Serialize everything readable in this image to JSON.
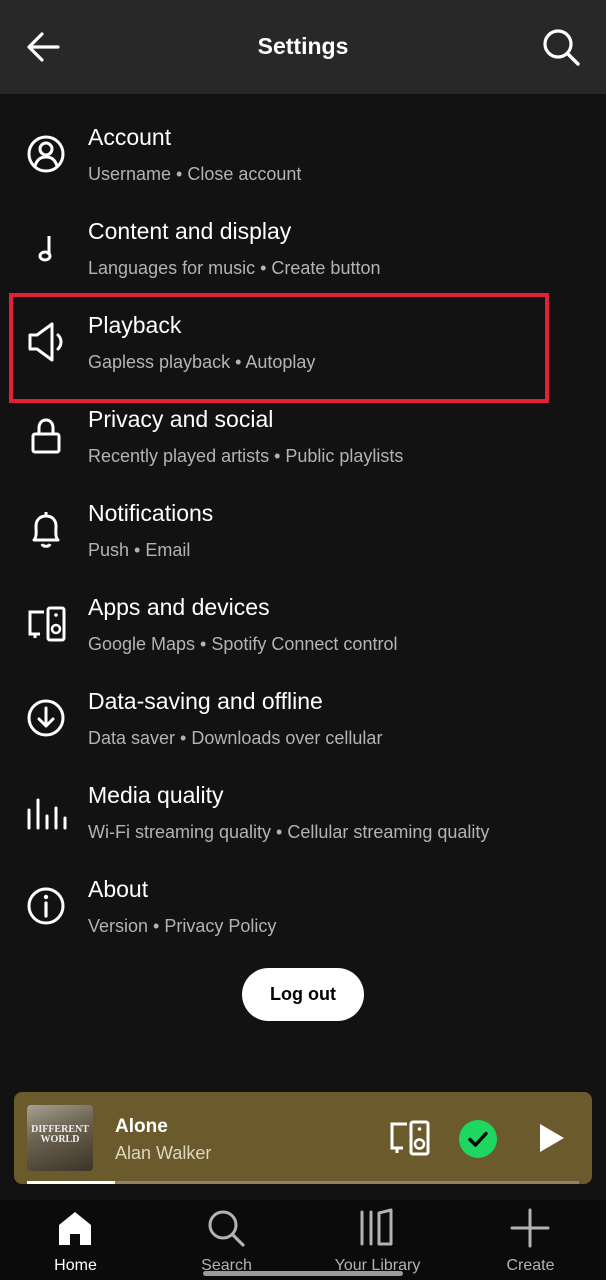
{
  "header": {
    "title": "Settings",
    "back_icon": "arrow-left-icon",
    "search_icon": "search-icon"
  },
  "settings": [
    {
      "label": "Account",
      "sub": "Username • Close account",
      "icon": "account-icon"
    },
    {
      "label": "Content and display",
      "sub": "Languages for music • Create button",
      "icon": "music-note-icon"
    },
    {
      "label": "Playback",
      "sub": "Gapless playback • Autoplay",
      "icon": "speaker-icon"
    },
    {
      "label": "Privacy and social",
      "sub": "Recently played artists • Public playlists",
      "icon": "lock-icon"
    },
    {
      "label": "Notifications",
      "sub": "Push • Email",
      "icon": "bell-icon"
    },
    {
      "label": "Apps and devices",
      "sub": "Google Maps • Spotify Connect control",
      "icon": "devices-icon"
    },
    {
      "label": "Data-saving and offline",
      "sub": "Data saver • Downloads over cellular",
      "icon": "download-icon"
    },
    {
      "label": "Media quality",
      "sub": "Wi-Fi streaming quality • Cellular streaming quality",
      "icon": "equalizer-icon"
    },
    {
      "label": "About",
      "sub": "Version • Privacy Policy",
      "icon": "info-icon"
    }
  ],
  "highlight_color": "#e22134",
  "logout_label": "Log out",
  "player": {
    "album_art_text": "DIFFERENT WORLD",
    "track": "Alone",
    "artist": "Alan Walker",
    "progress": 0.16,
    "accent": "#1ed760"
  },
  "nav": {
    "items": [
      {
        "label": "Home",
        "icon": "home-icon",
        "active": true
      },
      {
        "label": "Search",
        "icon": "search-icon",
        "active": false
      },
      {
        "label": "Your Library",
        "icon": "library-icon",
        "active": false
      },
      {
        "label": "Create",
        "icon": "plus-icon",
        "active": false
      }
    ]
  }
}
